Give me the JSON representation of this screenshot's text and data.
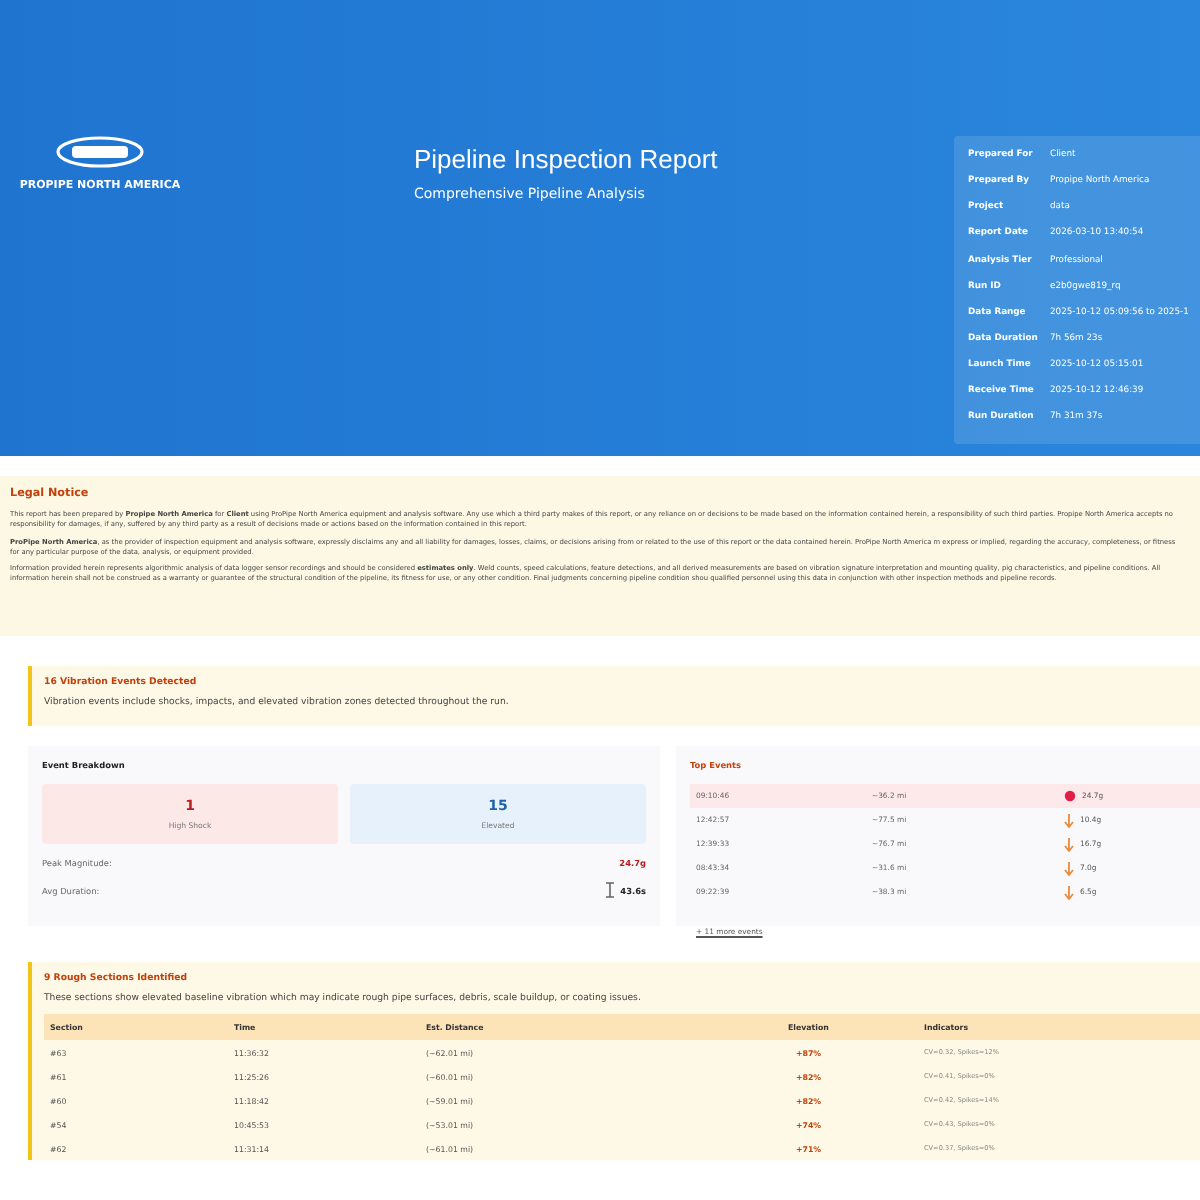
{
  "header": {
    "company": "PROPIPE NORTH AMERICA",
    "title": "Pipeline Inspection Report",
    "subtitle": "Comprehensive Pipeline Analysis",
    "meta": [
      {
        "label": "Prepared For",
        "value": "Client"
      },
      {
        "label": "Prepared By",
        "value": "Propipe North America"
      },
      {
        "label": "Project",
        "value": "data"
      },
      {
        "label": "Report Date",
        "value": "2026-03-10 13:40:54"
      },
      {
        "label": "Analysis Tier",
        "value": "Professional"
      },
      {
        "label": "Run ID",
        "value": "e2b0gwe819_rq"
      },
      {
        "label": "Data Range",
        "value": "2025-10-12 05:09:56 to 2025-1"
      },
      {
        "label": "Data Duration",
        "value": "7h 56m 23s"
      },
      {
        "label": "Launch Time",
        "value": "2025-10-12 05:15:01"
      },
      {
        "label": "Receive Time",
        "value": "2025-10-12 12:46:39"
      },
      {
        "label": "Run Duration",
        "value": "7h 31m 37s"
      }
    ]
  },
  "legal": {
    "title": "Legal Notice",
    "paragraphs": [
      "This report has been prepared by **Propipe North America** for **Client** using ProPipe North America equipment and analysis software. Any use which a third party makes of this report, or any reliance on or decisions to be made based on the information contained herein, a responsibility of such third parties. Propipe North America accepts no responsibility for damages, if any, suffered by any third party as a result of decisions made or actions based on the information contained in this report.",
      "**ProPipe North America**, as the provider of inspection equipment and analysis software, expressly disclaims any and all liability for damages, losses, claims, or decisions arising from or related to the use of this report or the data contained herein. ProPipe North America m express or implied, regarding the accuracy, completeness, or fitness for any particular purpose of the data, analysis, or equipment provided.",
      "Information provided herein represents algorithmic analysis of data logger sensor recordings and should be considered **estimates only**. Weld counts, speed calculations, feature detections, and all derived measurements are based on vibration signature interpretation and mounting quality, pig characteristics, and pipeline conditions. All information herein shall not be construed as a warranty or guarantee of the structural condition of the pipeline, its fitness for use, or any other condition. Final judgments concerning pipeline condition shou qualified personnel using this data in conjunction with other inspection methods and pipeline records."
    ]
  },
  "vibration": {
    "title": "16 Vibration Events Detected",
    "text": "Vibration events include shocks, impacts, and elevated vibration zones detected throughout the run."
  },
  "breakdown": {
    "title": "Event Breakdown",
    "tiles": [
      {
        "kind": "shock",
        "value": "1",
        "label": "High Shock"
      },
      {
        "kind": "elevated",
        "value": "15",
        "label": "Elevated"
      }
    ],
    "stats": [
      {
        "label": "Peak Magnitude:",
        "value": "24.7g",
        "kind": "peak"
      },
      {
        "label": "Avg Duration:",
        "value": "43.6s",
        "kind": "duration"
      }
    ]
  },
  "top_events": {
    "title": "Top Events",
    "rows": [
      {
        "time": "09:10:46",
        "distance": "~36.2 mi",
        "magnitude": "24.7g",
        "kind": "high_shock"
      },
      {
        "time": "12:42:57",
        "distance": "~77.5 mi",
        "magnitude": "10.4g",
        "kind": "elevated"
      },
      {
        "time": "12:39:33",
        "distance": "~76.7 mi",
        "magnitude": "16.7g",
        "kind": "elevated"
      },
      {
        "time": "08:43:34",
        "distance": "~31.6 mi",
        "magnitude": "7.0g",
        "kind": "elevated"
      },
      {
        "time": "09:22:39",
        "distance": "~38.3 mi",
        "magnitude": "6.5g",
        "kind": "elevated"
      }
    ],
    "more": "+ 11 more events"
  },
  "rough": {
    "title": "9 Rough Sections Identified",
    "text": "These sections show elevated baseline vibration which may indicate rough pipe surfaces, debris, scale buildup, or coating issues.",
    "columns": [
      "Section",
      "Time",
      "Est. Distance",
      "Elevation",
      "Indicators"
    ],
    "rows": [
      [
        "#63",
        "11:36:32",
        "(~62.01 mi)",
        "+87%",
        "CV=0.32, Spikes=12%"
      ],
      [
        "#61",
        "11:25:26",
        "(~60.01 mi)",
        "+82%",
        "CV=0.41, Spikes=0%"
      ],
      [
        "#60",
        "11:18:42",
        "(~59.01 mi)",
        "+82%",
        "CV=0.42, Spikes=14%"
      ],
      [
        "#54",
        "10:45:53",
        "(~53.01 mi)",
        "+74%",
        "CV=0.43, Spikes=0%"
      ],
      [
        "#62",
        "11:31:14",
        "(~61.01 mi)",
        "+71%",
        "CV=0.37, Spikes=0%"
      ]
    ]
  }
}
